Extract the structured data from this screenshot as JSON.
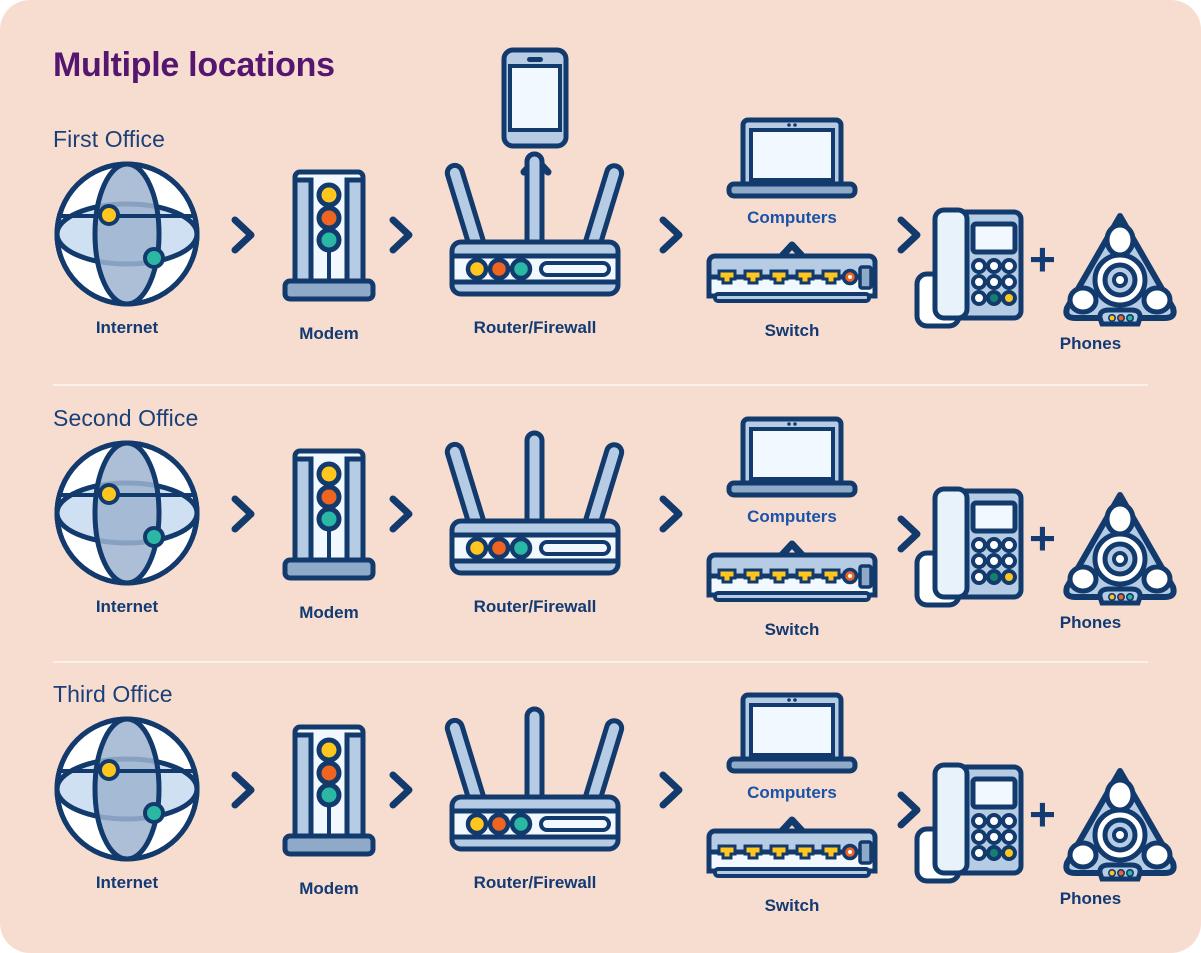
{
  "page": {
    "title": "Multiple locations",
    "background_color": "#f7ddd0",
    "title_color": "#54166f",
    "label_color": "#133a72",
    "sublabel_color": "#1a52a8",
    "office_heading_color": "#1b3f77",
    "divider_color": "#fbf1eb"
  },
  "palette": {
    "navy": "#123a6d",
    "light_blue": "#b6cce4",
    "pale_blue": "#f2f8ff",
    "mid_blue": "#8fa9c8",
    "yellow": "#ffc61e",
    "orange": "#ef6421",
    "teal": "#2ab8a4",
    "white": "#ffffff"
  },
  "offices": [
    {
      "heading": "First Office",
      "nodes": {
        "internet": {
          "label": "Internet",
          "icon": "globe-icon"
        },
        "modem": {
          "label": "Modem",
          "icon": "modem-icon",
          "leds": [
            "#ffc61e",
            "#ef6421",
            "#2ab8a4"
          ]
        },
        "router": {
          "label": "Router/Firewall",
          "icon": "router-icon",
          "leds": [
            "#ffc61e",
            "#ef6421",
            "#2ab8a4"
          ],
          "antennas": 3
        },
        "smartphone": {
          "label": "",
          "icon": "smartphone-icon"
        },
        "computers": {
          "label": "Computers",
          "icon": "laptop-icon"
        },
        "switch": {
          "label": "Switch",
          "icon": "switch-icon",
          "ports": 5
        },
        "phones": {
          "label": "Phones",
          "icon": "desk-phone-icon",
          "secondary_icon": "conference-phone-icon",
          "connector": "+"
        }
      }
    },
    {
      "heading": "Second Office",
      "nodes": {
        "internet": {
          "label": "Internet",
          "icon": "globe-icon"
        },
        "modem": {
          "label": "Modem",
          "icon": "modem-icon",
          "leds": [
            "#ffc61e",
            "#ef6421",
            "#2ab8a4"
          ]
        },
        "router": {
          "label": "Router/Firewall",
          "icon": "router-icon",
          "leds": [
            "#ffc61e",
            "#ef6421",
            "#2ab8a4"
          ],
          "antennas": 3
        },
        "computers": {
          "label": "Computers",
          "icon": "laptop-icon"
        },
        "switch": {
          "label": "Switch",
          "icon": "switch-icon",
          "ports": 5
        },
        "phones": {
          "label": "Phones",
          "icon": "desk-phone-icon",
          "secondary_icon": "conference-phone-icon",
          "connector": "+"
        }
      }
    },
    {
      "heading": "Third Office",
      "nodes": {
        "internet": {
          "label": "Internet",
          "icon": "globe-icon"
        },
        "modem": {
          "label": "Modem",
          "icon": "modem-icon",
          "leds": [
            "#ffc61e",
            "#ef6421",
            "#2ab8a4"
          ]
        },
        "router": {
          "label": "Router/Firewall",
          "icon": "router-icon",
          "leds": [
            "#ffc61e",
            "#ef6421",
            "#2ab8a4"
          ],
          "antennas": 3
        },
        "computers": {
          "label": "Computers",
          "icon": "laptop-icon"
        },
        "switch": {
          "label": "Switch",
          "icon": "switch-icon",
          "ports": 5
        },
        "phones": {
          "label": "Phones",
          "icon": "desk-phone-icon",
          "secondary_icon": "conference-phone-icon",
          "connector": "+"
        }
      }
    }
  ],
  "flow": {
    "chevron_right": "›",
    "chevron_up": "^",
    "plus": "+"
  }
}
